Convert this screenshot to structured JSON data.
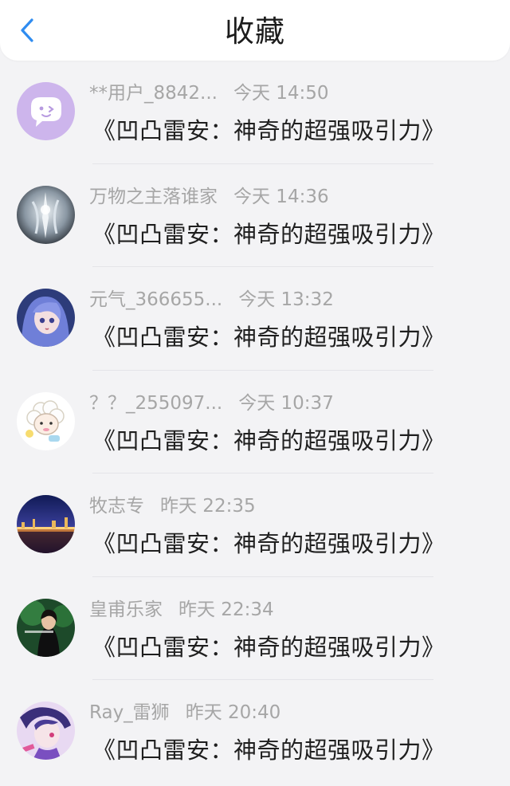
{
  "header": {
    "title": "收藏",
    "back_icon": "chevron-left-icon",
    "accent": "#2f8cf0"
  },
  "items": [
    {
      "user": "**用户_8842...",
      "time": "今天 14:50",
      "content": "《凹凸雷安：神奇的超强吸引力》",
      "avatar": "purple-chat-bubble"
    },
    {
      "user": "万物之主落谁家",
      "time": "今天 14:36",
      "content": "《凹凸雷安：神奇的超强吸引力》",
      "avatar": "white-haired-figure"
    },
    {
      "user": "元气_366655...",
      "time": "今天 13:32",
      "content": "《凹凸雷安：神奇的超强吸引力》",
      "avatar": "anime-girl-purple-hair"
    },
    {
      "user": "？？_255097...",
      "time": "今天 10:37",
      "content": "《凹凸雷安：神奇的超强吸引力》",
      "avatar": "cartoon-sheep"
    },
    {
      "user": "牧志专",
      "time": "昨天 22:35",
      "content": "《凹凸雷安：神奇的超强吸引力》",
      "avatar": "night-city-skyline"
    },
    {
      "user": "皇甫乐家",
      "time": "昨天 22:34",
      "content": "《凹凸雷安：神奇的超强吸引力》",
      "avatar": "girl-green-background"
    },
    {
      "user": "Ray_雷狮",
      "time": "昨天 20:40",
      "content": "《凹凸雷安：神奇的超强吸引力》",
      "avatar": "anime-boy-purple"
    }
  ]
}
